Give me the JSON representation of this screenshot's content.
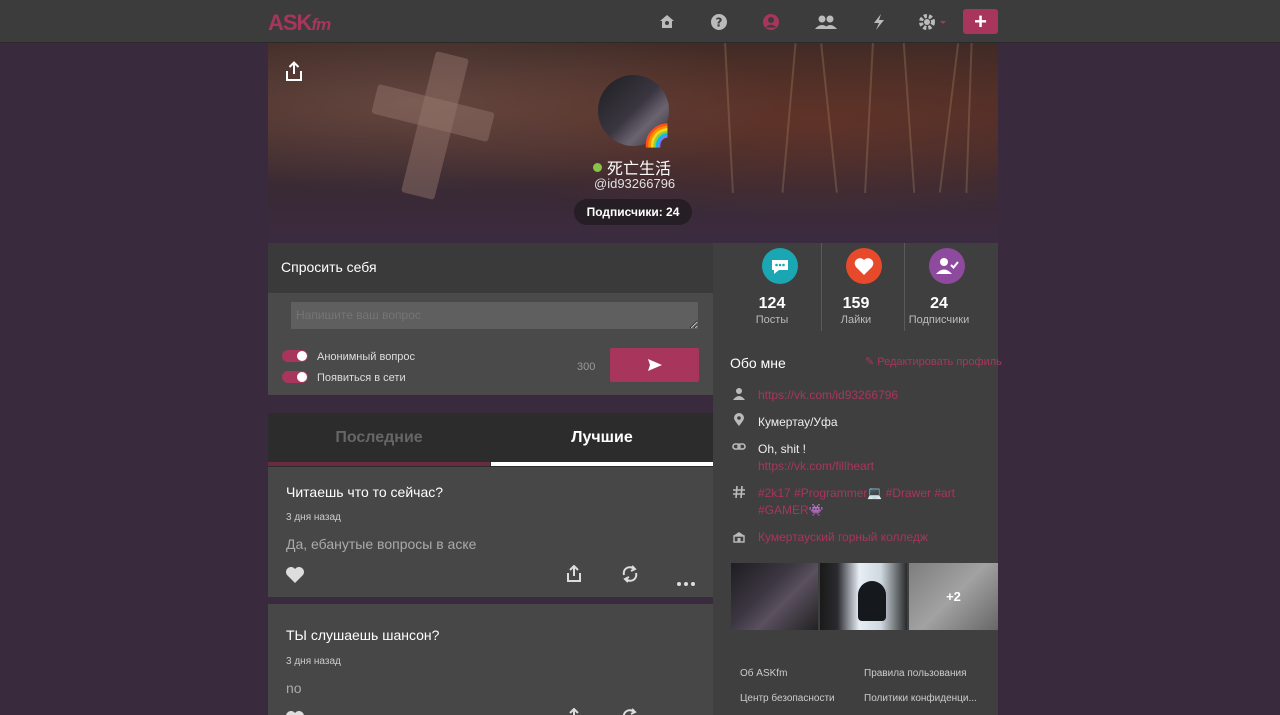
{
  "header": {
    "logo": "ASK",
    "logo_fm": "fm",
    "nav_icons": [
      "home-icon",
      "question-icon",
      "profile-icon",
      "friends-icon",
      "lightning-icon",
      "gear-icon"
    ],
    "accent": "#a8365c"
  },
  "profile": {
    "username": "死亡生活",
    "handle": "@id93266796",
    "subscribers_pill": "Подписчики: 24",
    "badge": "🌈"
  },
  "ask": {
    "title": "Спросить себя",
    "placeholder": "Напишите ваш вопрос",
    "anonymous_label": "Анонимный вопрос",
    "online_label": "Появиться в сети",
    "char_counter": "300"
  },
  "tabs": [
    "Последние",
    "Лучшие"
  ],
  "posts": [
    {
      "question": "Читаешь что то сейчас?",
      "time": "3 дня назад",
      "answer": "Да, ебанутые вопросы в аске"
    },
    {
      "question": "ТЫ слушаешь шансон?",
      "time": "3 дня назад",
      "answer": "no"
    }
  ],
  "stats": [
    {
      "value": "124",
      "label": "Посты",
      "color": "#1ba6b3"
    },
    {
      "value": "159",
      "label": "Лайки",
      "color": "#e64a2a"
    },
    {
      "value": "24",
      "label": "Подписчики",
      "color": "#8e4a9e"
    }
  ],
  "about": {
    "title": "Обо мне",
    "edit_label": "Редактировать профиль",
    "vk_link": "https://vk.com/id93266796",
    "location": "Кумертау/Уфа",
    "bio": "Oh, shit !",
    "bio_link": "https://vk.com/fillheart",
    "hashtags_line1": "#2k17 #Programmer💻 #Drawer #art",
    "hashtags_line2": "#GAMER👾",
    "school": "Кумертауский горный колледж"
  },
  "photos": {
    "more_count": "+2"
  },
  "footer": {
    "about": "Об ASKfm",
    "rules": "Правила пользования",
    "safety": "Центр безопасности",
    "privacy": "Политики конфиденци..."
  }
}
